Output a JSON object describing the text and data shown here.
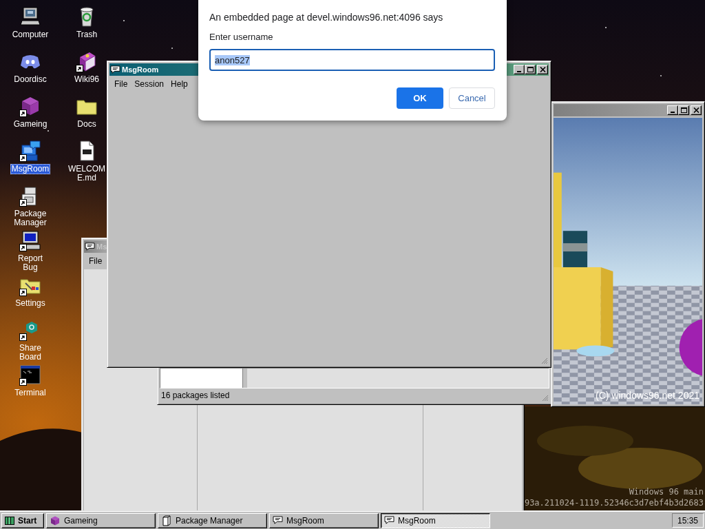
{
  "desktop": {
    "icons": [
      {
        "label": "Computer",
        "kind": "computer",
        "shortcut": false,
        "selected": false
      },
      {
        "label": "Doordisc",
        "kind": "controller",
        "shortcut": false,
        "selected": false
      },
      {
        "label": "Gameing",
        "kind": "cube",
        "shortcut": true,
        "selected": false
      },
      {
        "label": "MsgRoom",
        "kind": "chat_computer",
        "shortcut": true,
        "selected": true
      },
      {
        "label": "Package Manager",
        "kind": "package",
        "shortcut": true,
        "selected": false
      },
      {
        "label": "Report Bug",
        "kind": "monitor",
        "shortcut": true,
        "selected": false
      },
      {
        "label": "Settings",
        "kind": "tools_folder",
        "shortcut": true,
        "selected": false
      },
      {
        "label": "Share Board",
        "kind": "hexagon",
        "shortcut": true,
        "selected": false
      },
      {
        "label": "Terminal",
        "kind": "terminal",
        "shortcut": true,
        "selected": false
      },
      {
        "label": "Trash",
        "kind": "trash",
        "shortcut": false,
        "selected": false
      },
      {
        "label": "Wiki96",
        "kind": "book",
        "shortcut": true,
        "selected": false
      },
      {
        "label": "Docs",
        "kind": "folder",
        "shortcut": false,
        "selected": false
      },
      {
        "label": "WELCOME.md",
        "kind": "document",
        "shortcut": false,
        "selected": false
      }
    ],
    "build_info": [
      "Windows 96 main",
      "93a.211024-1119.52346c3d7ebf4b3d2683"
    ]
  },
  "windows": [
    {
      "kind": "chat",
      "title": "Ms",
      "active": false,
      "menu": [
        "File"
      ]
    },
    {
      "kind": "packages",
      "status": "16 packages listed"
    },
    {
      "kind": "game",
      "active": false,
      "overlay_text": "(C) windows96.net 2021"
    },
    {
      "kind": "blank",
      "title": "MsgRoom",
      "active": true,
      "menu": [
        "File",
        "Session",
        "Help"
      ]
    }
  ],
  "prompt": {
    "heading": "An embedded page at devel.windows96.net:4096 says",
    "message": "Enter username",
    "value": "anon527",
    "value_selected": true,
    "buttons": [
      {
        "label": "OK",
        "kind": "primary"
      },
      {
        "label": "Cancel",
        "kind": "secondary"
      }
    ]
  },
  "taskbar": {
    "start": "Start",
    "tasks": [
      {
        "label": "Gameing",
        "kind": "game",
        "selected": false
      },
      {
        "label": "Package Manager",
        "kind": "packages",
        "selected": false
      },
      {
        "label": "MsgRoom",
        "kind": "chat",
        "selected": false
      },
      {
        "label": "MsgRoom",
        "kind": "chat",
        "selected": true
      }
    ],
    "clock": "15:35"
  }
}
